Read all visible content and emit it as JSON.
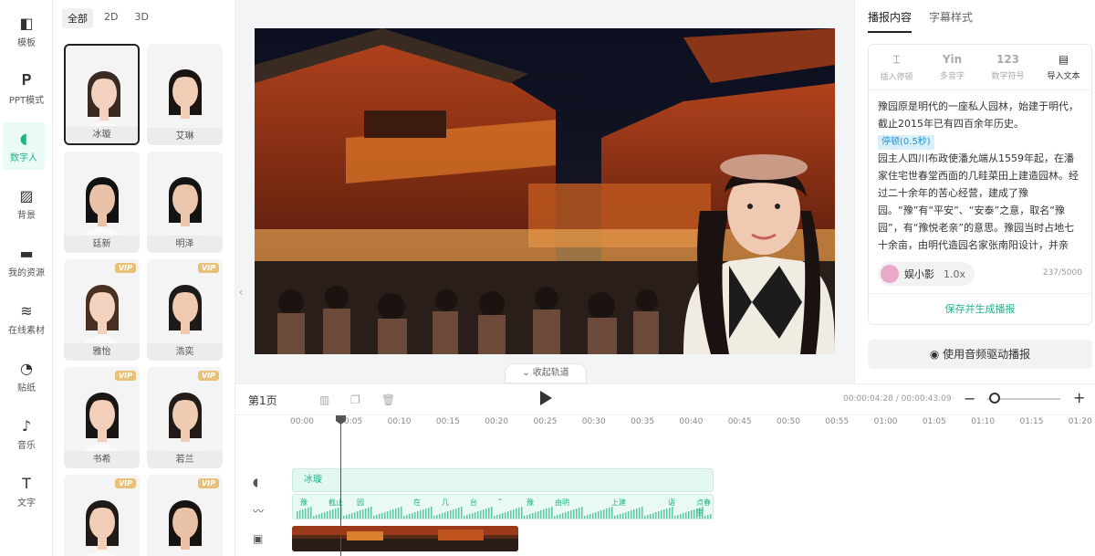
{
  "rail": [
    {
      "label": "模板",
      "icon": "template-icon"
    },
    {
      "label": "PPT模式",
      "icon": "ppt-icon"
    },
    {
      "label": "数字人",
      "icon": "digital-human-icon",
      "active": true
    },
    {
      "label": "背景",
      "icon": "background-icon"
    },
    {
      "label": "我的资源",
      "icon": "folder-icon"
    },
    {
      "label": "在线素材",
      "icon": "layers-icon"
    },
    {
      "label": "贴纸",
      "icon": "sticker-icon"
    },
    {
      "label": "音乐",
      "icon": "music-icon"
    },
    {
      "label": "文字",
      "icon": "text-icon"
    }
  ],
  "filters": [
    "全部",
    "2D",
    "3D"
  ],
  "avatars": [
    {
      "name": "冰璇",
      "vip": false,
      "selected": true
    },
    {
      "name": "艾琳",
      "vip": false
    },
    {
      "name": "廷新",
      "vip": false
    },
    {
      "name": "明泽",
      "vip": false
    },
    {
      "name": "雅怡",
      "vip": true
    },
    {
      "name": "浩奕",
      "vip": true
    },
    {
      "name": "书希",
      "vip": true
    },
    {
      "name": "若兰",
      "vip": true
    },
    {
      "name": "",
      "vip": true
    },
    {
      "name": "",
      "vip": true
    }
  ],
  "vip_label": "VIP",
  "collapse_label": "收起轨道",
  "right": {
    "tabs": [
      "播报内容",
      "字幕样式"
    ],
    "tools": [
      {
        "glyph": "⌶",
        "label": "插入停顿"
      },
      {
        "glyph": "Yin",
        "label": "多音字"
      },
      {
        "glyph": "123",
        "label": "数字符号"
      },
      {
        "glyph": "▤",
        "label": "导入文本"
      }
    ],
    "script_p1": "豫园原是明代的一座私人园林，始建于明代，截止2015年已有四百余年历史。",
    "pause_tag": "停顿(0.5秒)",
    "script_p2": "园主人四川布政使潘允端从1559年起，在潘家住宅世春堂西面的几畦菜田上建造园林。经过二十余年的苦心经营，建成了豫园。“豫”有“平安”、“安泰”之意，取名“豫园”，有“豫悦老亲”的意思。豫园当时占地七十余亩，由明代造园名家张南阳设计，并亲",
    "voice_name": "娱小影",
    "voice_speed": "1.0x",
    "char_count": "237/5000",
    "save_label": "保存并生成播报",
    "audio_label": "使用音频驱动播报"
  },
  "timeline": {
    "page_label": "第1页",
    "timecode": "00:00:04:28 / 00:00:43:09",
    "ticks": [
      "00:00",
      "00:05",
      "00:10",
      "00:15",
      "00:20",
      "00:25",
      "00:30",
      "00:35",
      "00:40",
      "00:45",
      "00:50",
      "00:55",
      "01:00",
      "01:05",
      "01:10",
      "01:15",
      "01:20"
    ],
    "person_clip": "冰璇",
    "audio_words": [
      "豫",
      "截止",
      "园",
      "",
      "在",
      "几",
      "台",
      "“",
      "豫",
      "由明",
      "",
      "上建",
      "",
      "语",
      "点春堂"
    ]
  },
  "colors": {
    "accent": "#1fb38a",
    "vip": "#e8c077"
  }
}
